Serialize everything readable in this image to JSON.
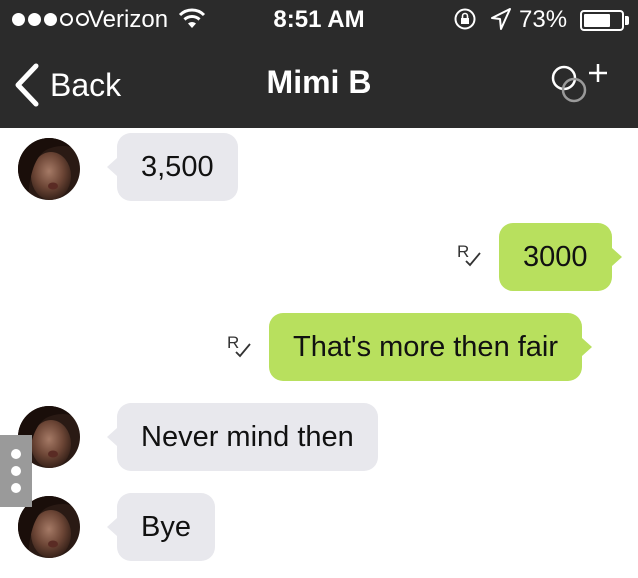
{
  "status_bar": {
    "signal_bars": 5,
    "signal_filled": 3,
    "carrier": "Verizon",
    "time": "8:51 AM",
    "battery_percent": "73%",
    "battery_level": 0.73
  },
  "nav": {
    "back_label": "Back",
    "title": "Mimi B",
    "add_icon": "add-to-group-icon"
  },
  "messages": [
    {
      "direction": "incoming",
      "text": "3,500",
      "avatar": true
    },
    {
      "direction": "outgoing",
      "text": "3000",
      "read_receipt": "R"
    },
    {
      "direction": "outgoing",
      "text": "That's more then fair",
      "read_receipt": "R"
    },
    {
      "direction": "incoming",
      "text": "Never mind then",
      "avatar": true
    },
    {
      "direction": "incoming",
      "text": "Bye",
      "avatar": true
    }
  ],
  "colors": {
    "header": "#2b2b2b",
    "incoming_bubble": "#e8e8ed",
    "outgoing_bubble": "#b8e05e"
  }
}
